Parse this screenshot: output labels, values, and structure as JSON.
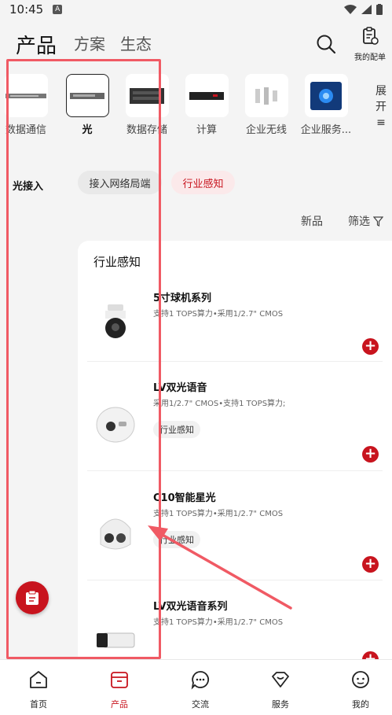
{
  "status": {
    "time": "10:45",
    "notif": "A"
  },
  "header": {
    "tabs": [
      "产品",
      "方案",
      "生态"
    ],
    "order_label": "我的配单"
  },
  "categories": [
    {
      "label": "数据通信"
    },
    {
      "label": "光"
    },
    {
      "label": "数据存储"
    },
    {
      "label": "计算"
    },
    {
      "label": "企业无线"
    },
    {
      "label": "企业服务..."
    }
  ],
  "expand": {
    "label1": "展",
    "label2": "开",
    "icon": "≡"
  },
  "left_nav": {
    "item": "光接入"
  },
  "chips": [
    "接入网络局端",
    "行业感知"
  ],
  "toolbar": {
    "new": "新品",
    "filter": "筛选"
  },
  "panel": {
    "title": "行业感知",
    "products": [
      {
        "name": "5寸球机系列",
        "desc": "支持1 TOPS算力•采用1/2.7\" CMOS",
        "tag": ""
      },
      {
        "name": "LV双光语音",
        "desc": "采用1/2.7\" CMOS•支持1 TOPS算力;",
        "tag": "行业感知"
      },
      {
        "name": "C10智能星光",
        "desc": "支持1 TOPS算力•采用1/2.7\" CMOS",
        "tag": "行业感知"
      },
      {
        "name": "LV双光语音系列",
        "desc": "支持1 TOPS算力•采用1/2.7\" CMOS",
        "tag": ""
      }
    ]
  },
  "bottom_nav": [
    {
      "label": "首页"
    },
    {
      "label": "产品"
    },
    {
      "label": "交流"
    },
    {
      "label": "服务"
    },
    {
      "label": "我的"
    }
  ],
  "colors": {
    "accent": "#c8141e",
    "annotation": "#f05a64"
  }
}
